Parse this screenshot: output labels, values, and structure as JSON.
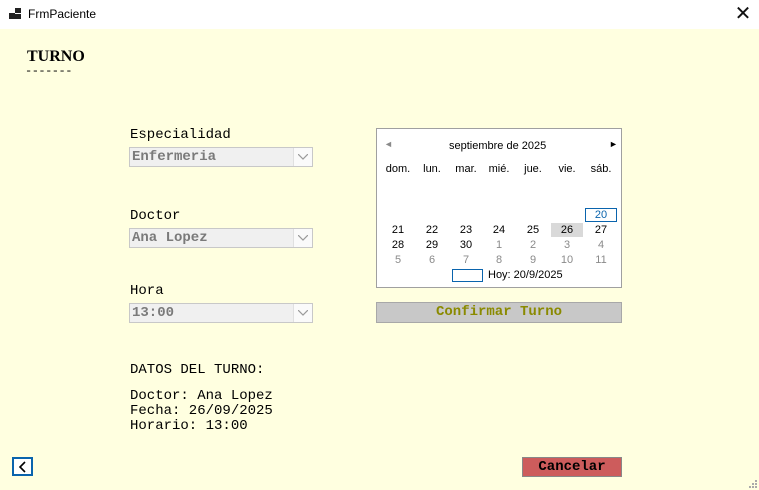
{
  "window": {
    "title": "FrmPaciente",
    "close_label": "✕"
  },
  "heading": {
    "text": "TURNO",
    "underline": "-------"
  },
  "especialidad": {
    "label": "Especialidad",
    "value": "Enfermeria"
  },
  "doctor": {
    "label": "Doctor",
    "value": "Ana Lopez"
  },
  "hora": {
    "label": "Hora",
    "value": "13:00"
  },
  "calendar": {
    "prev_label": "◄",
    "next_label": "►",
    "month_label": "septiembre de 2025",
    "weekdays": [
      "dom.",
      "lun.",
      "mar.",
      "mié.",
      "jue.",
      "vie.",
      "sáb."
    ],
    "rows": [
      [
        "",
        "",
        "",
        "",
        "",
        "",
        "20"
      ],
      [
        "21",
        "22",
        "23",
        "24",
        "25",
        "26",
        "27"
      ],
      [
        "28",
        "29",
        "30",
        "1",
        "2",
        "3",
        "4"
      ],
      [
        "5",
        "6",
        "7",
        "8",
        "9",
        "10",
        "11"
      ]
    ],
    "selected_day": "26",
    "today_day": "20",
    "today_label": "Hoy: 20/9/2025"
  },
  "confirm_button": "Confirmar Turno",
  "datos": {
    "title": "DATOS DEL TURNO:",
    "doctor_line": "Doctor: Ana Lopez",
    "fecha_line": "Fecha: 26/09/2025",
    "horario_line": "Horario: 13:00"
  },
  "cancel_button": "Cancelar",
  "icons": {
    "back": "chevron-left-icon",
    "app": "app-window-icon",
    "close": "close-icon"
  },
  "colors": {
    "background": "#ffffe0",
    "accent": "#0a64ad",
    "confirm_text": "#8a8a00",
    "cancel_bg": "#cd5c5c"
  }
}
